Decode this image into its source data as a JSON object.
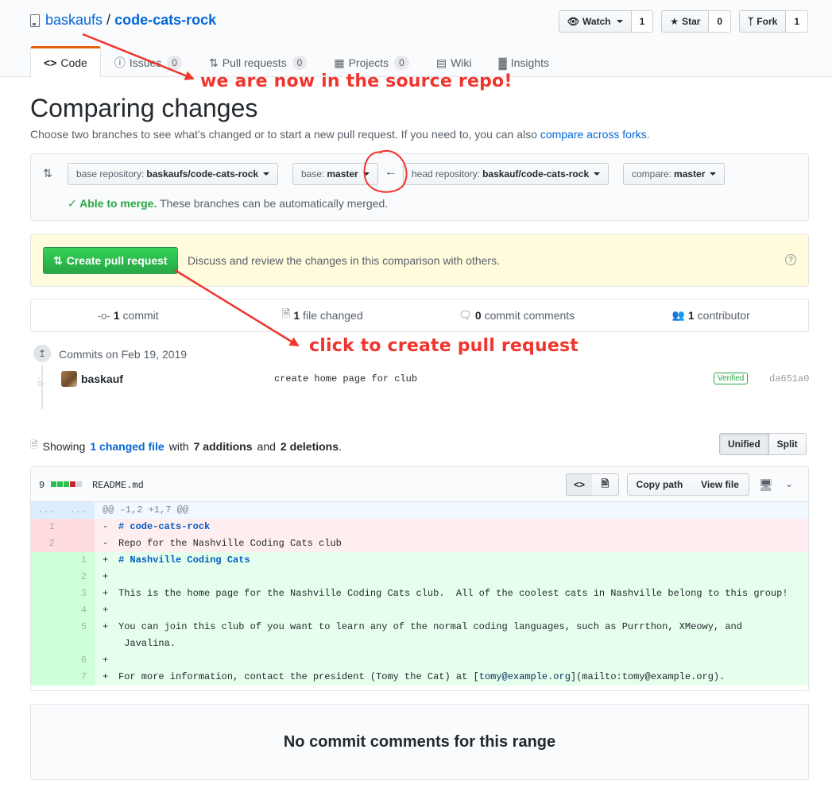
{
  "repo": {
    "owner": "baskaufs",
    "separator": "/",
    "name": "code-cats-rock"
  },
  "actions": {
    "watch": {
      "label": "Watch",
      "count": "1"
    },
    "star": {
      "label": "Star",
      "count": "0"
    },
    "fork": {
      "label": "Fork",
      "count": "1"
    }
  },
  "nav": {
    "code": "Code",
    "issues": {
      "label": "Issues",
      "count": "0"
    },
    "pulls": {
      "label": "Pull requests",
      "count": "0"
    },
    "projects": {
      "label": "Projects",
      "count": "0"
    },
    "wiki": "Wiki",
    "insights": "Insights"
  },
  "page": {
    "title": "Comparing changes",
    "subtitle": "Choose two branches to see what’s changed or to start a new pull request. If you need to, you can also",
    "subtitle_link": "compare across forks",
    "subtitle_end": "."
  },
  "range": {
    "base_repo_prefix": "base repository:",
    "base_repo": "baskaufs/code-cats-rock",
    "base_prefix": "base:",
    "base": "master",
    "head_repo_prefix": "head repository:",
    "head_repo": "baskauf/code-cats-rock",
    "compare_prefix": "compare:",
    "compare": "master",
    "merge_check": "✓ Able to merge.",
    "merge_note": "These branches can be automatically merged."
  },
  "pr": {
    "button": "Create pull request",
    "description": "Discuss and review the changes in this comparison with others."
  },
  "summary": {
    "commits": {
      "count": "1",
      "label": "commit"
    },
    "files": {
      "count": "1",
      "label": "file changed"
    },
    "comments": {
      "count": "0",
      "label": "commit comments"
    },
    "contributors": {
      "count": "1",
      "label": "contributor"
    }
  },
  "commits": {
    "date": "Commits on Feb 19, 2019",
    "author": "baskauf",
    "message": "create home page for club",
    "badge": "Verified",
    "sha": "da651a0"
  },
  "diff_summary": {
    "prefix": "Showing",
    "files_link": "1 changed file",
    "with": "with",
    "additions": "7 additions",
    "and": "and",
    "deletions": "2 deletions",
    "end": ".",
    "unified": "Unified",
    "split": "Split"
  },
  "file": {
    "change_count": "9",
    "name": "README.md",
    "copy_path": "Copy path",
    "view_file": "View file",
    "hunk": "@@ -1,2 +1,7 @@",
    "hunk_num": "...",
    "lines": [
      {
        "type": "del",
        "old": "1",
        "new": "",
        "sign": "-",
        "text": "# code-cats-rock"
      },
      {
        "type": "del",
        "old": "2",
        "new": "",
        "sign": "-",
        "text": "Repo for the Nashville Coding Cats club"
      },
      {
        "type": "add",
        "old": "",
        "new": "1",
        "sign": "+",
        "text": "# Nashville Coding Cats"
      },
      {
        "type": "add",
        "old": "",
        "new": "2",
        "sign": "+",
        "text": ""
      },
      {
        "type": "add",
        "old": "",
        "new": "3",
        "sign": "+",
        "text": "This is the home page for the Nashville Coding Cats club.  All of the coolest cats in Nashville belong to this group!"
      },
      {
        "type": "add",
        "old": "",
        "new": "4",
        "sign": "+",
        "text": ""
      },
      {
        "type": "add",
        "old": "",
        "new": "5",
        "sign": "+",
        "text": "You can join this club of you want to learn any of the normal coding languages, such as Purrthon, XMeowy, and"
      },
      {
        "type": "add",
        "old": "",
        "new": "",
        "sign": "",
        "text": " Javalina."
      },
      {
        "type": "add",
        "old": "",
        "new": "6",
        "sign": "+",
        "text": ""
      },
      {
        "type": "add",
        "old": "",
        "new": "7",
        "sign": "+",
        "text": "For more information, contact the president (Tomy the Cat) at [tomy@example.org](mailto:tomy@example.org)."
      }
    ]
  },
  "no_comments": "No commit comments for this range",
  "annotations": {
    "source_repo": "we are now in the source repo!",
    "create_pr": "click to create pull request",
    "color": "#f0352e"
  }
}
